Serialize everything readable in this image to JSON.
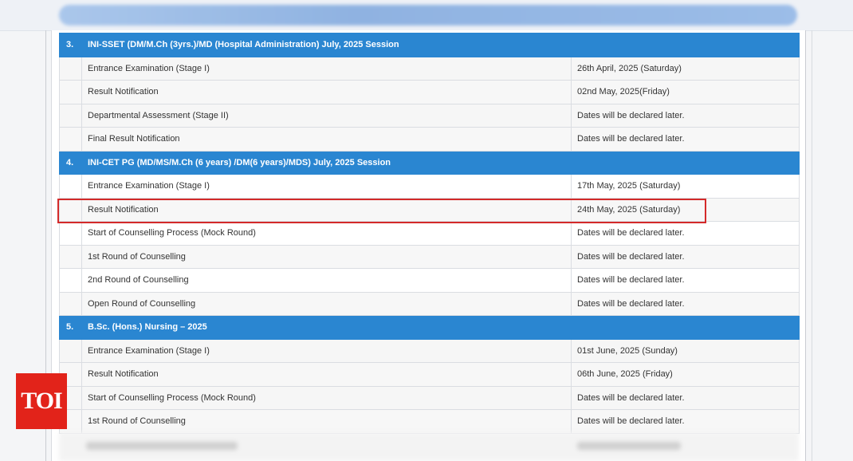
{
  "logo": {
    "text": "TOI"
  },
  "colors": {
    "header_blue": "#2a86d1",
    "highlight_red": "#d42a2a",
    "logo_red": "#e2231a"
  },
  "sections": [
    {
      "number": "3.",
      "title": "INI-SSET (DM/M.Ch (3yrs.)/MD (Hospital Administration) July, 2025 Session",
      "rows": [
        {
          "event": "Entrance Examination (Stage I)",
          "date": "26th April, 2025 (Saturday)"
        },
        {
          "event": "Result Notification",
          "date": "02nd May, 2025(Friday)"
        },
        {
          "event": "Departmental Assessment (Stage II)",
          "date": "Dates will be declared later."
        },
        {
          "event": "Final Result Notification",
          "date": "Dates will be declared later."
        }
      ]
    },
    {
      "number": "4.",
      "title": "INI-CET PG (MD/MS/M.Ch (6 years) /DM(6 years)/MDS) July, 2025 Session",
      "rows": [
        {
          "event": "Entrance Examination (Stage I)",
          "date": "17th May, 2025 (Saturday)"
        },
        {
          "event": "Result Notification",
          "date": "24th May, 2025 (Saturday)"
        },
        {
          "event": "Start of Counselling Process (Mock Round)",
          "date": "Dates will be declared later."
        },
        {
          "event": "1st Round of Counselling",
          "date": "Dates will be declared later."
        },
        {
          "event": "2nd Round of Counselling",
          "date": "Dates will be declared later."
        },
        {
          "event": "Open Round of Counselling",
          "date": "Dates will be declared later."
        }
      ]
    },
    {
      "number": "5.",
      "title": "B.Sc. (Hons.) Nursing – 2025",
      "rows": [
        {
          "event": "Entrance Examination (Stage I)",
          "date": "01st June, 2025 (Sunday)"
        },
        {
          "event": "Result Notification",
          "date": "06th June, 2025 (Friday)"
        },
        {
          "event": "Start of Counselling Process (Mock Round)",
          "date": "Dates will be declared later."
        },
        {
          "event": "1st Round of Counselling",
          "date": "Dates will be declared later."
        }
      ]
    }
  ]
}
